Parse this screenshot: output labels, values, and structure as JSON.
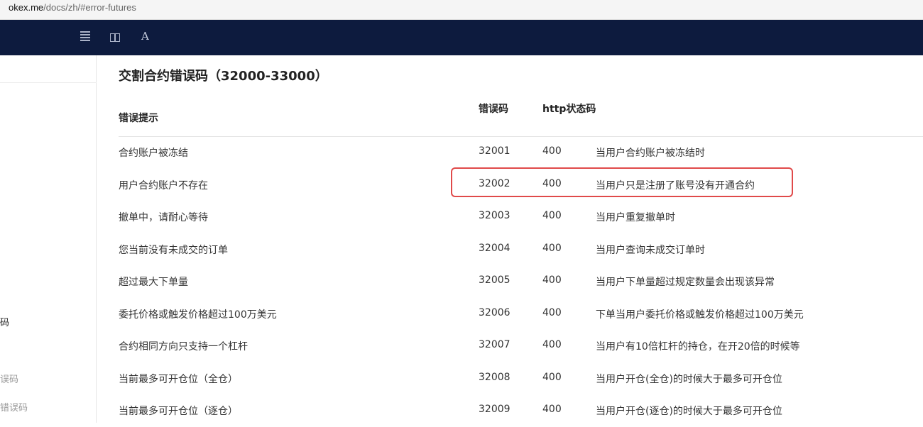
{
  "browser": {
    "url_host": "okex.me",
    "url_path": "/docs/zh/#error-futures"
  },
  "toolbar": {
    "menu_icon": "menu-icon",
    "split_icon": "columns-icon",
    "font_icon": "A"
  },
  "sidebar": {
    "items": [
      "码",
      "",
      "误码",
      "错误码"
    ]
  },
  "page": {
    "title": "交割合约错误码（32000-33000）",
    "headers": {
      "message": "错误提示",
      "code": "错误码",
      "http": "http状态码"
    }
  },
  "rows": [
    {
      "message": "合约账户被冻结",
      "code": "32001",
      "http": "400",
      "desc": "当用户合约账户被冻结时"
    },
    {
      "message": "用户合约账户不存在",
      "code": "32002",
      "http": "400",
      "desc": "当用户只是注册了账号没有开通合约"
    },
    {
      "message": "撤单中，请耐心等待",
      "code": "32003",
      "http": "400",
      "desc": "当用户重复撤单时"
    },
    {
      "message": "您当前没有未成交的订单",
      "code": "32004",
      "http": "400",
      "desc": "当用户查询未成交订单时"
    },
    {
      "message": "超过最大下单量",
      "code": "32005",
      "http": "400",
      "desc": "当用户下单量超过规定数量会出现该异常"
    },
    {
      "message": "委托价格或触发价格超过100万美元",
      "code": "32006",
      "http": "400",
      "desc": "下单当用户委托价格或触发价格超过100万美元"
    },
    {
      "message": "合约相同方向只支持一个杠杆",
      "code": "32007",
      "http": "400",
      "desc": "当用户有10倍杠杆的持仓，在开20倍的时候等"
    },
    {
      "message": "当前最多可开仓位（全仓）",
      "code": "32008",
      "http": "400",
      "desc": "当用户开仓(全仓)的时候大于最多可开仓位"
    },
    {
      "message": "当前最多可开仓位（逐仓）",
      "code": "32009",
      "http": "400",
      "desc": "当用户开仓(逐仓)的时候大于最多可开仓位"
    }
  ],
  "colors": {
    "topbar": "#0d1b3e",
    "highlight": "#e04a4a"
  }
}
